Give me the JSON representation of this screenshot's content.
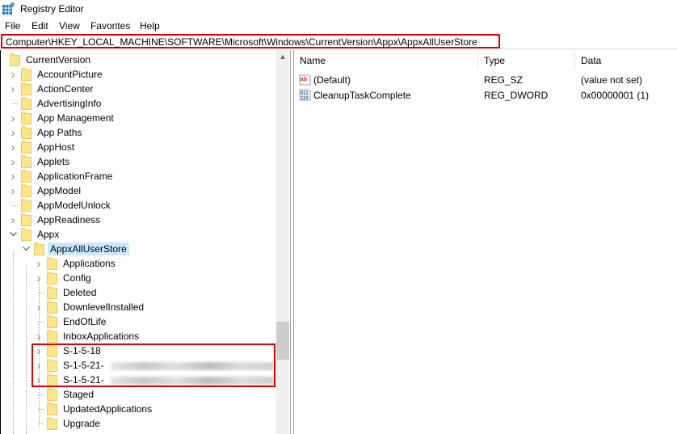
{
  "window": {
    "title": "Registry Editor"
  },
  "menu": [
    "File",
    "Edit",
    "View",
    "Favorites",
    "Help"
  ],
  "address": {
    "path": "Computer\\HKEY_LOCAL_MACHINE\\SOFTWARE\\Microsoft\\Windows\\CurrentVersion\\Appx\\AppxAllUserStore"
  },
  "tree": {
    "root": "CurrentVersion",
    "items": [
      {
        "label": "AccountPicture",
        "level": 1,
        "expander": "collapsed"
      },
      {
        "label": "ActionCenter",
        "level": 1,
        "expander": "collapsed"
      },
      {
        "label": "AdvertisingInfo",
        "level": 1,
        "expander": "none"
      },
      {
        "label": "App Management",
        "level": 1,
        "expander": "collapsed"
      },
      {
        "label": "App Paths",
        "level": 1,
        "expander": "collapsed"
      },
      {
        "label": "AppHost",
        "level": 1,
        "expander": "collapsed"
      },
      {
        "label": "Applets",
        "level": 1,
        "expander": "collapsed"
      },
      {
        "label": "ApplicationFrame",
        "level": 1,
        "expander": "collapsed"
      },
      {
        "label": "AppModel",
        "level": 1,
        "expander": "collapsed"
      },
      {
        "label": "AppModelUnlock",
        "level": 1,
        "expander": "none"
      },
      {
        "label": "AppReadiness",
        "level": 1,
        "expander": "collapsed"
      },
      {
        "label": "Appx",
        "level": 1,
        "expander": "expanded"
      },
      {
        "label": "AppxAllUserStore",
        "level": 2,
        "expander": "expanded",
        "selected": true
      },
      {
        "label": "Applications",
        "level": 3,
        "expander": "collapsed"
      },
      {
        "label": "Config",
        "level": 3,
        "expander": "collapsed"
      },
      {
        "label": "Deleted",
        "level": 3,
        "expander": "none"
      },
      {
        "label": "DownlevelInstalled",
        "level": 3,
        "expander": "collapsed"
      },
      {
        "label": "EndOfLife",
        "level": 3,
        "expander": "none"
      },
      {
        "label": "InboxApplications",
        "level": 3,
        "expander": "collapsed"
      },
      {
        "label": "S-1-5-18",
        "level": 3,
        "expander": "collapsed"
      },
      {
        "label": "S-1-5-21-",
        "level": 3,
        "expander": "collapsed",
        "blurred_suffix": true
      },
      {
        "label": "S-1-5-21-",
        "level": 3,
        "expander": "collapsed",
        "blurred_suffix": true
      },
      {
        "label": "Staged",
        "level": 3,
        "expander": "none"
      },
      {
        "label": "UpdatedApplications",
        "level": 3,
        "expander": "none"
      },
      {
        "label": "Upgrade",
        "level": 3,
        "expander": "none"
      }
    ]
  },
  "values": {
    "columns": [
      "Name",
      "Type",
      "Data"
    ],
    "rows": [
      {
        "icon": "string-value-icon",
        "name": "(Default)",
        "type": "REG_SZ",
        "data": "(value not set)"
      },
      {
        "icon": "binary-value-icon",
        "name": "CleanupTaskComplete",
        "type": "REG_DWORD",
        "data": "0x00000001 (1)"
      }
    ]
  },
  "colors": {
    "highlight": "#e00000",
    "selection": "#cce8ff",
    "folder": "#fde58a"
  }
}
